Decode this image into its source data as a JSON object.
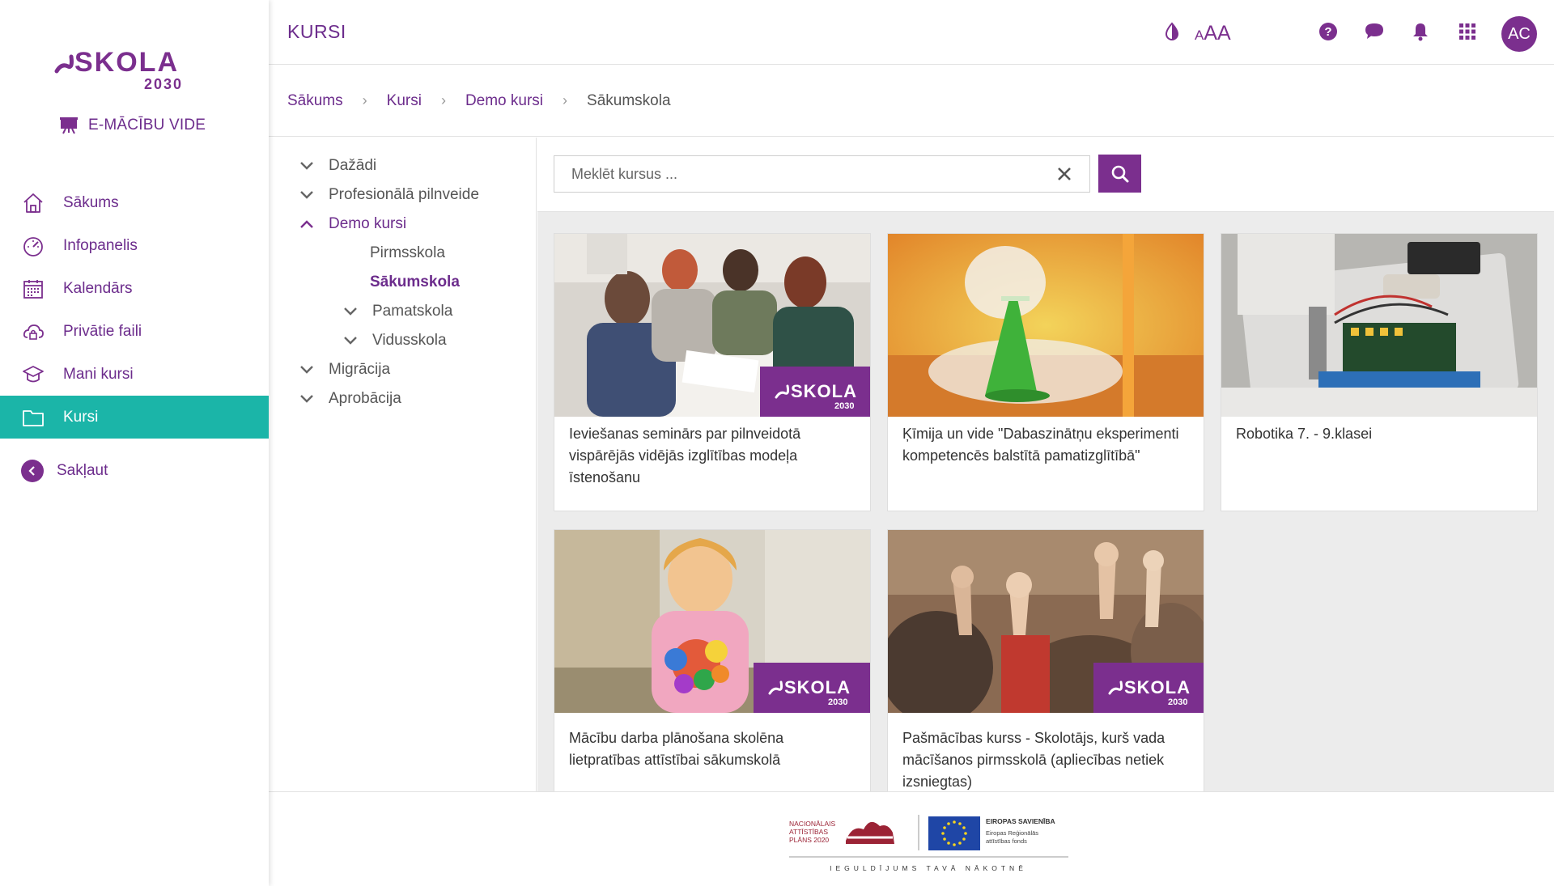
{
  "app": {
    "logo_text": "SKOLA",
    "logo_year": "2030",
    "env_label": "E-MĀCĪBU VIDE"
  },
  "sidebar": {
    "items": [
      {
        "label": "Sākums",
        "icon": "home-icon"
      },
      {
        "label": "Infopanelis",
        "icon": "dashboard-icon"
      },
      {
        "label": "Kalendārs",
        "icon": "calendar-icon"
      },
      {
        "label": "Privātie faili",
        "icon": "cloud-lock-icon"
      },
      {
        "label": "Mani kursi",
        "icon": "graduation-cap-icon"
      },
      {
        "label": "Kursi",
        "icon": "folder-icon",
        "active": true
      }
    ],
    "collapse_label": "Sakļaut"
  },
  "header": {
    "title": "KURSI",
    "font_size_small": "A",
    "font_size_large": "AA",
    "avatar_initials": "AC"
  },
  "breadcrumb": {
    "items": [
      "Sākums",
      "Kursi",
      "Demo kursi",
      "Sākumskola"
    ]
  },
  "tree": {
    "items": [
      {
        "label": "Dažādi",
        "level": 0,
        "expanded": false
      },
      {
        "label": "Profesionālā pilnveide",
        "level": 0,
        "expanded": false
      },
      {
        "label": "Demo kursi",
        "level": 0,
        "expanded": true
      },
      {
        "label": "Pirmsskola",
        "level": 1,
        "leaf": true
      },
      {
        "label": "Sākumskola",
        "level": 1,
        "leaf": true,
        "selected": true
      },
      {
        "label": "Pamatskola",
        "level": 1,
        "expanded": false
      },
      {
        "label": "Vidusskola",
        "level": 1,
        "expanded": false
      },
      {
        "label": "Migrācija",
        "level": 0,
        "expanded": false
      },
      {
        "label": "Aprobācija",
        "level": 0,
        "expanded": false
      }
    ]
  },
  "search": {
    "placeholder": "Meklēt kursus ..."
  },
  "courses": [
    {
      "title": "Ieviešanas seminārs par pilnveidotā vispārējās vidējās izglītības modeļa īstenošanu",
      "image": "seminar-photo",
      "badge": true
    },
    {
      "title": "Ķīmija un vide \"Dabaszinātņu eksperimenti kompetencēs balstītā pamatizglītībā\"",
      "image": "chemistry-flask-photo",
      "badge": false
    },
    {
      "title": "Robotika 7. - 9.klasei",
      "image": "robotics-board-photo",
      "badge": false
    },
    {
      "title": "Mācību darba plānošana skolēna lietpratības attīstībai sākumskolā",
      "image": "child-pompoms-photo",
      "badge": true
    },
    {
      "title": "Pašmācības kurss - Skolotājs, kurš vada mācīšanos pirmsskolā (apliecības netiek izsniegtas)",
      "image": "raised-hands-photo",
      "badge": true
    }
  ],
  "footer": {
    "nap_line1": "NACIONĀLAIS",
    "nap_line2": "ATTĪSTĪBAS",
    "nap_line3": "PLĀNS 2020",
    "eu_title": "EIROPAS SAVIENĪBA",
    "eu_fund1": "Eiropas Reģionālās",
    "eu_fund2": "attīstības fonds",
    "slogan": "IEGULDĪJUMS TAVĀ NĀKOTNĒ"
  },
  "colors": {
    "brand_purple": "#7b2f8e",
    "accent_teal": "#1bb5a8"
  }
}
